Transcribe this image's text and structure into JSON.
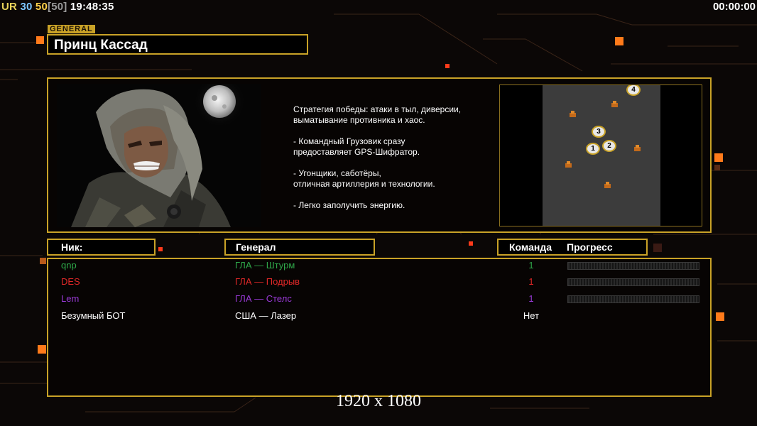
{
  "hud": {
    "ur_label": "UR",
    "ur_value": "30",
    "fps_value": "50",
    "fps_cap": "[50]",
    "clock": "19:48:35",
    "game_timer": "00:00:00"
  },
  "general": {
    "tag": "GENERAL",
    "name": "Принц Кассад",
    "description": "Стратегия победы: атаки в тыл, диверсии,\n выматывание противника и хаос.\n\n- Командный Грузовик сразу\nпредоставляет GPS-Шифратор.\n\n- Угонщики, саботёры,\nотличная артиллерия и технологии.\n\n- Легко заполучить энергию."
  },
  "minimap": {
    "spawns": [
      {
        "label": "4"
      },
      {
        "label": "3"
      },
      {
        "label": "1"
      },
      {
        "label": "2"
      }
    ]
  },
  "table": {
    "headers": {
      "nick": "Ник:",
      "general": "Генерал",
      "team": "Команда",
      "progress": "Прогресс"
    },
    "players": [
      {
        "nick": "qnp",
        "general": "ГЛА — Штурм",
        "team": "1",
        "color": "#2fa84a",
        "progress": 0
      },
      {
        "nick": "DES",
        "general": "ГЛА — Подрыв",
        "team": "1",
        "color": "#e02828",
        "progress": 0
      },
      {
        "nick": "Lem",
        "general": "ГЛА — Стелс",
        "team": "1",
        "color": "#9a3ad6",
        "progress": 0
      },
      {
        "nick": "Безумный БОТ",
        "general": "США — Лазер",
        "team": "Нет",
        "color": "#ffffff",
        "progress": null
      }
    ]
  },
  "footer": {
    "resolution": "1920 x 1080"
  },
  "colors": {
    "accent": "#c9a227",
    "background": "#0b0706",
    "orange_square": "#ff7a1a"
  }
}
